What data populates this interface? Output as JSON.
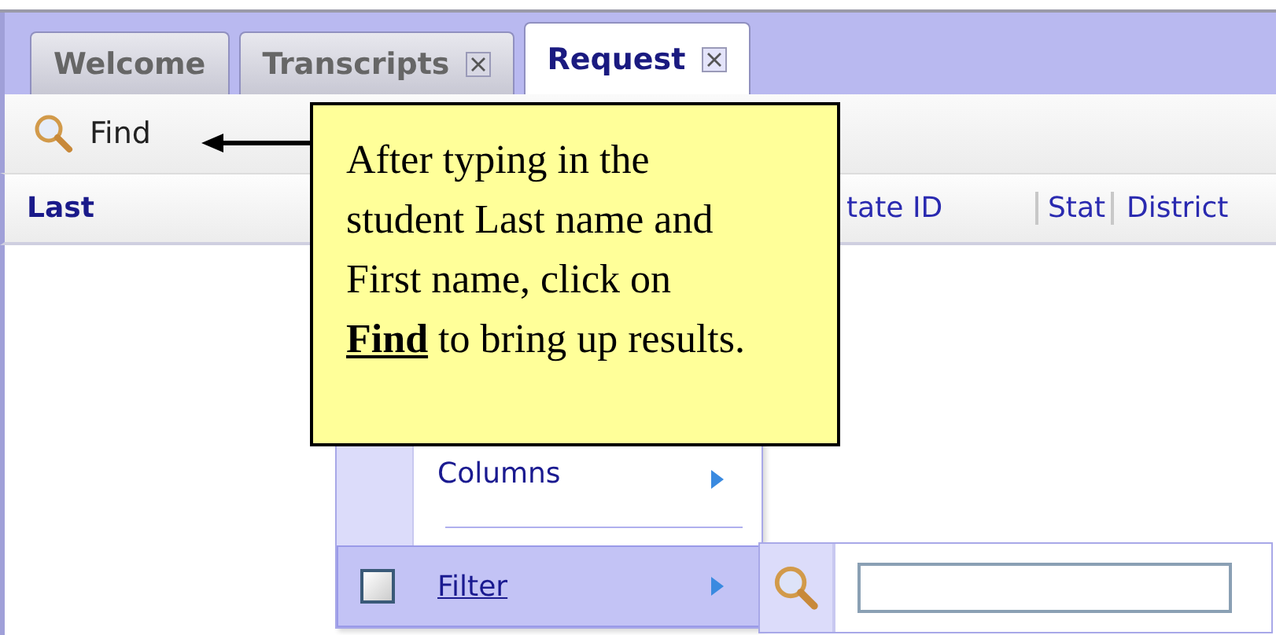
{
  "tabs": [
    {
      "label": "Welcome",
      "selected": false,
      "closable": false
    },
    {
      "label": "Transcripts",
      "selected": false,
      "closable": true
    },
    {
      "label": "Request",
      "selected": true,
      "closable": true
    }
  ],
  "toolbar": {
    "find_button": "Find"
  },
  "columns": [
    {
      "label": "Last"
    },
    {
      "label": "tate ID"
    },
    {
      "label": "Stat"
    },
    {
      "label": "District"
    }
  ],
  "callout": {
    "text": "After typing in the student Last name and First name, click on **Find** to bring up results."
  },
  "context_menu": {
    "items": [
      {
        "kind": "submenu",
        "label": "Columns",
        "selected": false
      },
      {
        "kind": "separator"
      },
      {
        "kind": "checkbox",
        "label": "Filter",
        "checked": false,
        "selected": true
      }
    ]
  }
}
